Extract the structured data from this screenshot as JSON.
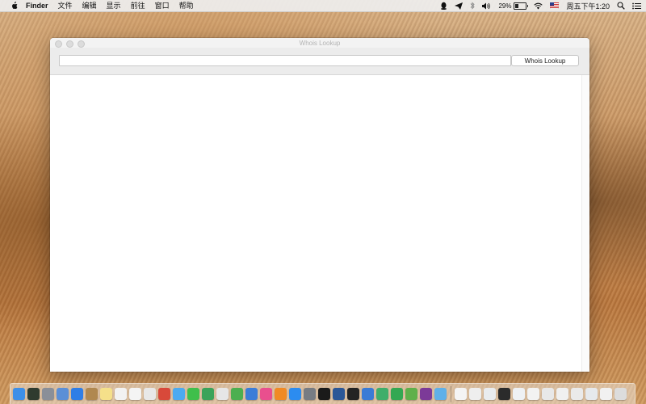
{
  "menubar": {
    "apple_icon": "apple-logo-icon",
    "app_name": "Finder",
    "items": [
      "文件",
      "编辑",
      "显示",
      "前往",
      "窗口",
      "帮助"
    ],
    "status": {
      "battery_percent": "29%",
      "battery_level": 0.29,
      "clock": "周五下午1:20",
      "icons": [
        "qq-penguin-icon",
        "telegram-icon",
        "bluetooth-icon",
        "volume-icon",
        "wifi-icon",
        "us-flag-input-icon",
        "spotlight-search-icon",
        "notification-list-icon"
      ]
    }
  },
  "window": {
    "title": "Whois Lookup",
    "search": {
      "value": "",
      "placeholder": ""
    },
    "lookup_button_label": "Whois Lookup"
  },
  "dock": {
    "apps": [
      {
        "icon": "finder-icon",
        "color": "#3d8fe8"
      },
      {
        "icon": "dashboard-icon",
        "color": "#2f3b2f"
      },
      {
        "icon": "launchpad-icon",
        "color": "#8a8f98"
      },
      {
        "icon": "preview-icon",
        "color": "#5b8fd6"
      },
      {
        "icon": "safari-icon",
        "color": "#2f7ee6"
      },
      {
        "icon": "notes-folder-icon",
        "color": "#b08850"
      },
      {
        "icon": "stickies-icon",
        "color": "#f5e08a"
      },
      {
        "icon": "calendar-icon",
        "color": "#f2f2f2"
      },
      {
        "icon": "textedit-icon",
        "color": "#f4f4f4"
      },
      {
        "icon": "photos-icon",
        "color": "#e8e8e8"
      },
      {
        "icon": "chrome-icon",
        "color": "#d8493a"
      },
      {
        "icon": "messages-icon",
        "color": "#4caaf0"
      },
      {
        "icon": "wechat-icon",
        "color": "#3fbf4b"
      },
      {
        "icon": "chrome-2-icon",
        "color": "#3aa35a"
      },
      {
        "icon": "script-icon",
        "color": "#e6e6e6"
      },
      {
        "icon": "numbers-icon",
        "color": "#4caf50"
      },
      {
        "icon": "keynote-icon",
        "color": "#3b7dd8"
      },
      {
        "icon": "itunes-icon",
        "color": "#e94f8e"
      },
      {
        "icon": "ibooks-icon",
        "color": "#f08a24"
      },
      {
        "icon": "app-store-icon",
        "color": "#2c8cf0"
      },
      {
        "icon": "system-preferences-icon",
        "color": "#777c83"
      },
      {
        "icon": "qq-icon",
        "color": "#1a1a1a"
      },
      {
        "icon": "word-icon",
        "color": "#2b5797"
      },
      {
        "icon": "terminal-icon",
        "color": "#232323"
      },
      {
        "icon": "xcode-icon",
        "color": "#3a7bd5"
      },
      {
        "icon": "network-icon",
        "color": "#3fae6a"
      },
      {
        "icon": "network-2-icon",
        "color": "#33a852"
      },
      {
        "icon": "sequel-icon",
        "color": "#5fb04b"
      },
      {
        "icon": "onenote-icon",
        "color": "#7c3a98"
      },
      {
        "icon": "drive-icon",
        "color": "#5fb0e8"
      }
    ],
    "docs": [
      {
        "icon": "document-icon",
        "color": "#f4f4f4"
      },
      {
        "icon": "screenshot-icon",
        "color": "#eeeeee"
      },
      {
        "icon": "screenshot-2-icon",
        "color": "#e9ecef"
      },
      {
        "icon": "terminal-screenshot-icon",
        "color": "#2b2b2b"
      },
      {
        "icon": "window-screenshot-icon",
        "color": "#eef1f4"
      },
      {
        "icon": "window-screenshot-2-icon",
        "color": "#f2f2f2"
      },
      {
        "icon": "window-screenshot-3-icon",
        "color": "#e8e8e8"
      },
      {
        "icon": "stack-icon",
        "color": "#f0f0f0"
      },
      {
        "icon": "stack-2-icon",
        "color": "#eaeaea"
      },
      {
        "icon": "stack-3-icon",
        "color": "#e6e9ec"
      },
      {
        "icon": "stack-4-icon",
        "color": "#f1f1f1"
      },
      {
        "icon": "trash-icon",
        "color": "#dcdcdc"
      }
    ]
  }
}
